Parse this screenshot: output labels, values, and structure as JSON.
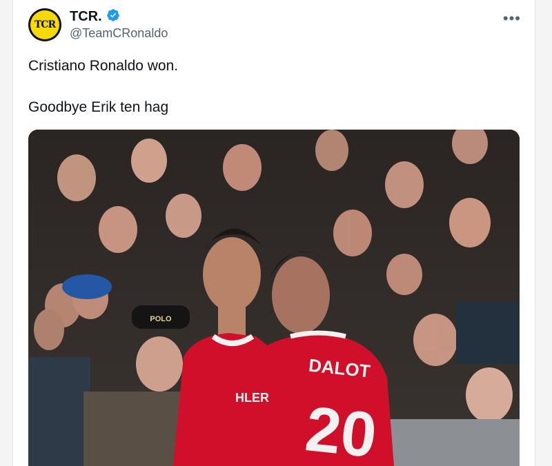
{
  "author": {
    "avatar_text": "TCR",
    "display_name": "TCR.",
    "handle": "@TeamCRonaldo",
    "verified": true
  },
  "menu": {
    "more_label": "•••"
  },
  "tweet": {
    "lines": [
      "Cristiano Ronaldo won.",
      "Goodbye Erik ten hag"
    ]
  },
  "media": {
    "description_icon": "photo",
    "jersey_name": "DALOT",
    "jersey_number": "20",
    "sleeve_text": "HLER",
    "cap_text": "POLO"
  },
  "colors": {
    "verified_blue": "#1d9bf0",
    "avatar_yellow": "#f5d90a",
    "kit_red": "#d0102a"
  }
}
